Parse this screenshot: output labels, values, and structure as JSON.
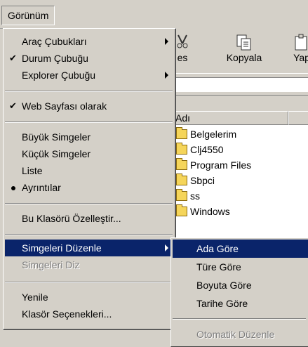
{
  "menubar": {
    "title": "Görünüm"
  },
  "toolbar": {
    "partial_left_label": "es",
    "copy_label": "Kopyala",
    "paste_label": "Yap"
  },
  "list_header": {
    "name_column": "Adı"
  },
  "files": [
    "Belgelerim",
    "Clj4550",
    "Program Files",
    "Sbpci",
    "ss",
    "Windows"
  ],
  "menu": {
    "toolbars": "Araç Çubukları",
    "status_bar": "Durum Çubuğu",
    "explorer_bar": "Explorer Çubuğu",
    "as_web_page": "Web Sayfası olarak",
    "large_icons": "Büyük Simgeler",
    "small_icons": "Küçük Simgeler",
    "list": "Liste",
    "details": "Ayrıntılar",
    "customize_folder": "Bu Klasörü Özelleştir...",
    "arrange_icons": "Simgeleri Düzenle",
    "line_up_icons": "Simgeleri Diz",
    "refresh": "Yenile",
    "folder_options": "Klasör Seçenekleri..."
  },
  "submenu": {
    "by_name": "Ada Göre",
    "by_type": "Türe Göre",
    "by_size": "Boyuta Göre",
    "by_date": "Tarihe Göre",
    "auto_arrange": "Otomatik Düzenle"
  },
  "colors": {
    "menu_face": "#d4d0c8",
    "highlight": "#0a246a",
    "disabled_text": "#808080"
  }
}
